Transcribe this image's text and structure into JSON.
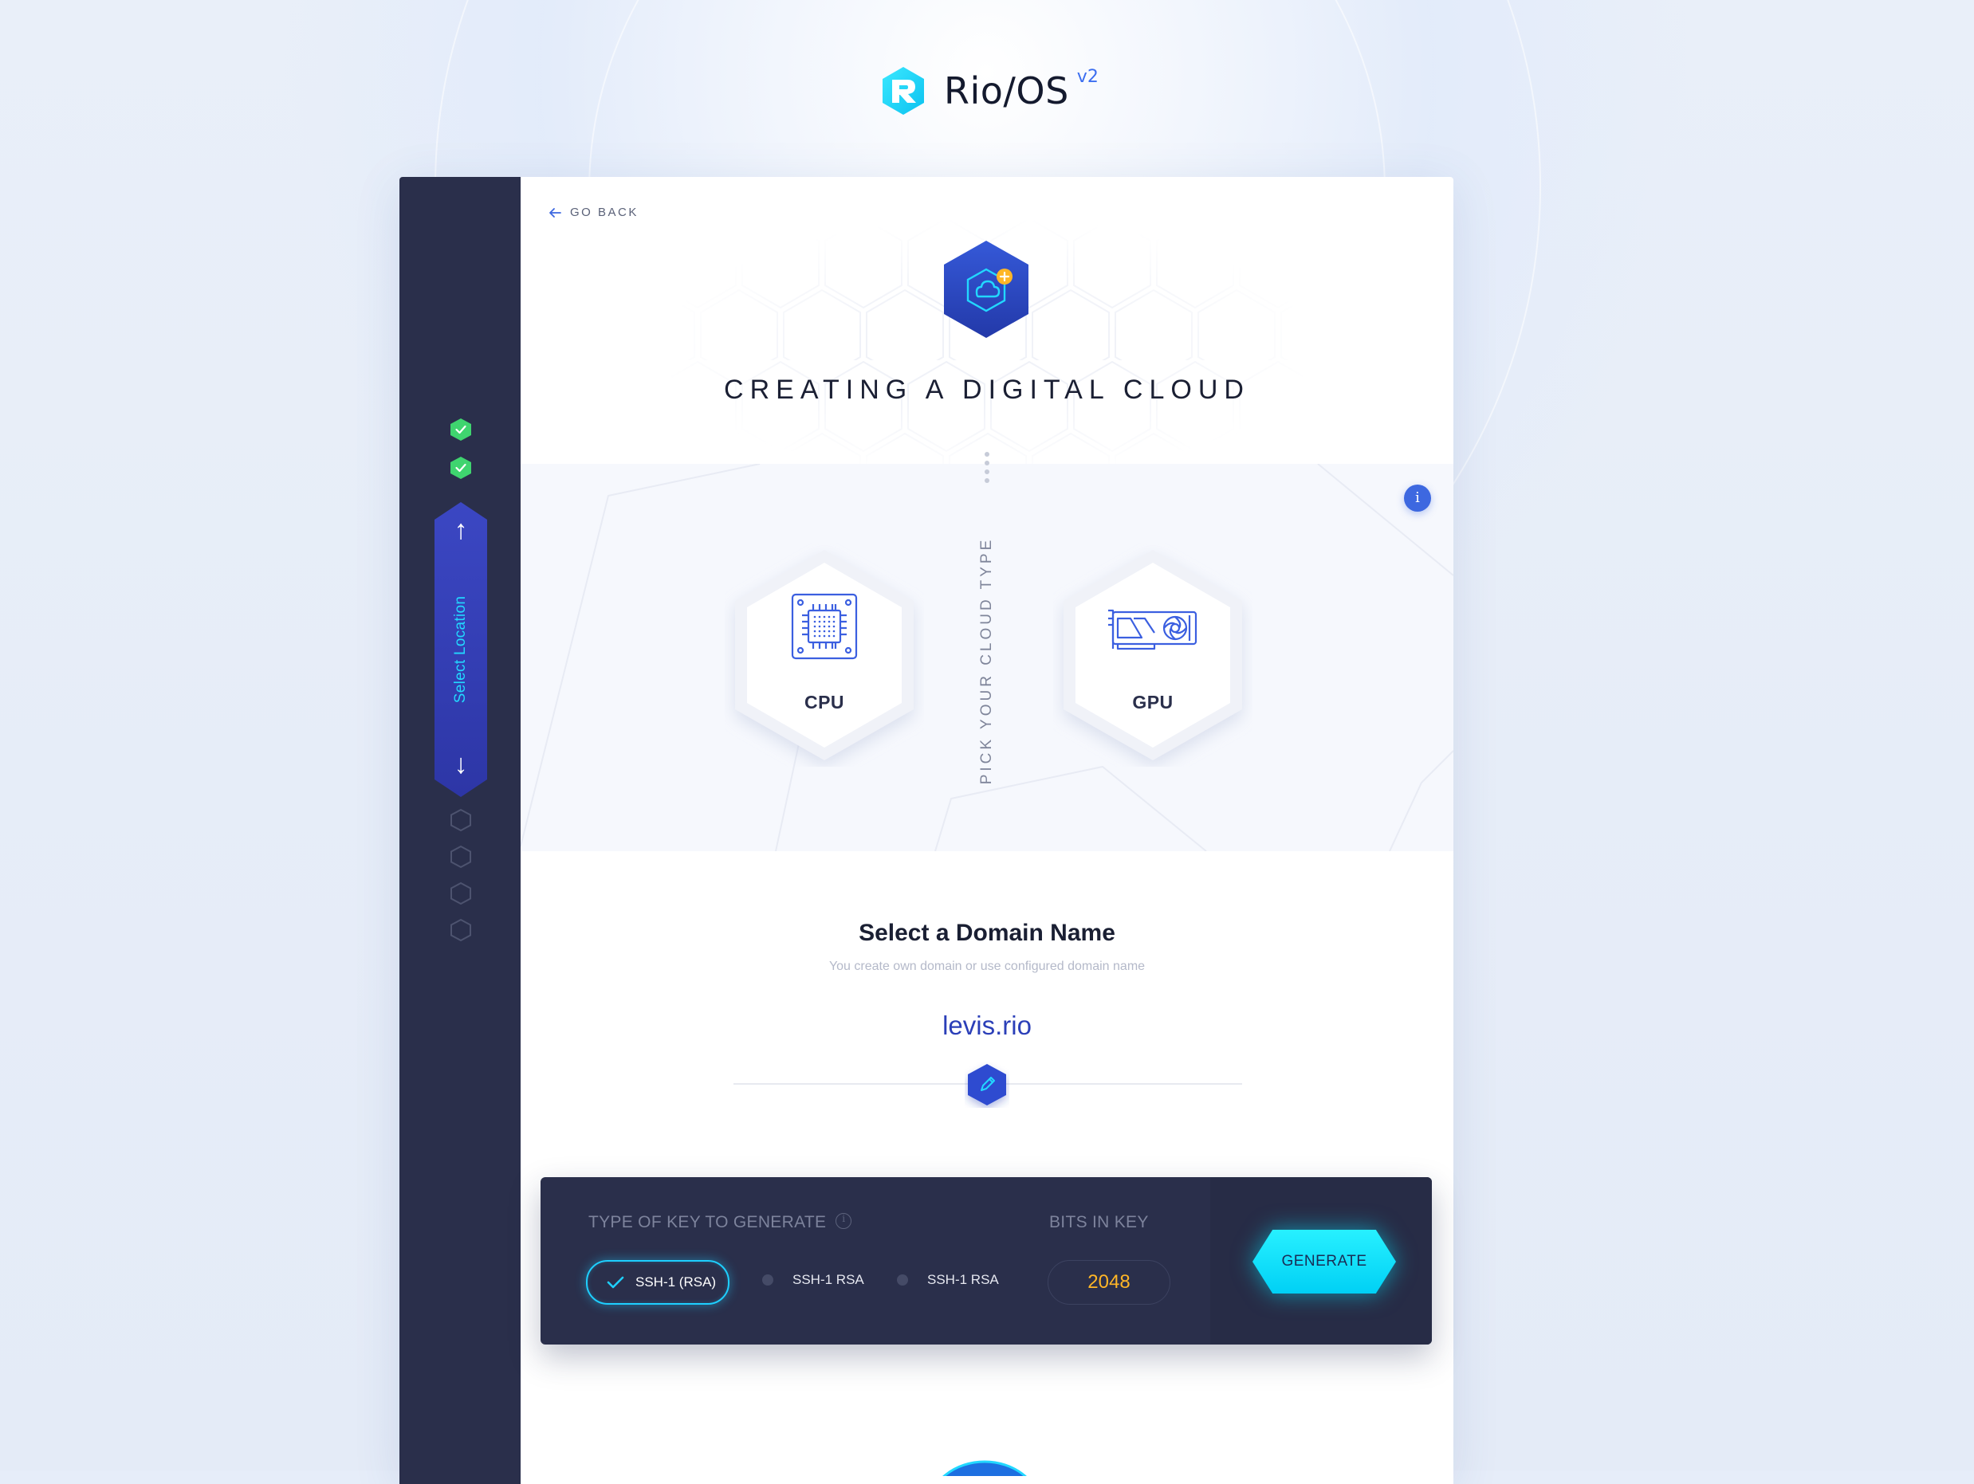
{
  "app": {
    "name": "Rio/OS",
    "version": "v2"
  },
  "nav": {
    "go_back": "GO BACK"
  },
  "sidebar": {
    "active_step": "Select Location",
    "completed_steps": 2,
    "pending_steps": 4
  },
  "page": {
    "title": "CREATING A DIGITAL CLOUD"
  },
  "cloud_type": {
    "prompt": "PICK YOUR CLOUD TYPE",
    "info": "i",
    "options": [
      {
        "label": "CPU",
        "icon": "cpu-chip-icon"
      },
      {
        "label": "GPU",
        "icon": "graphics-card-icon"
      }
    ]
  },
  "domain": {
    "title": "Select a Domain Name",
    "subtitle": "You create own domain or use configured domain name",
    "value": "levis.rio"
  },
  "key_gen": {
    "type_heading": "TYPE OF KEY TO GENERATE",
    "bits_heading": "BITS IN KEY",
    "options": [
      {
        "label": "SSH-1 (RSA)",
        "selected": true
      },
      {
        "label": "SSH-1 RSA",
        "selected": false
      },
      {
        "label": "SSH-1 RSA",
        "selected": false
      }
    ],
    "bits": "2048",
    "button": "GENERATE"
  },
  "colors": {
    "accent_blue": "#2b3fb8",
    "cyan": "#1ecfff",
    "sidebar_bg": "#2a2f4b",
    "success_green": "#3fd46f",
    "bits_yellow": "#ffb627"
  }
}
